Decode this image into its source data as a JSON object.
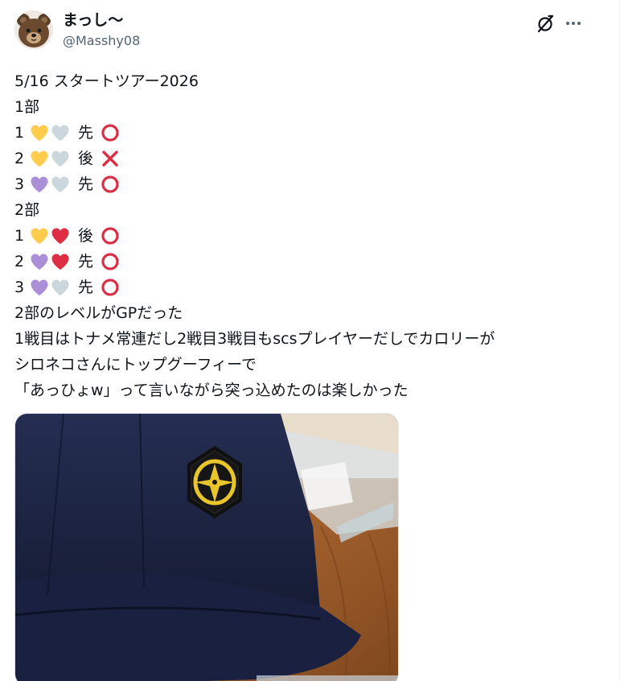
{
  "user": {
    "display_name": "まっし〜",
    "handle": "@Masshy08"
  },
  "icons": {
    "avatar": "teddy-bear-avatar",
    "grok": "grok-slash-icon",
    "more": "more-horizontal-icon"
  },
  "tweet": {
    "title_line": "5/16 スタートツアー2026",
    "part1_label": "1部",
    "part1_matches": [
      {
        "num": "1",
        "hearts": [
          "yellow",
          "white"
        ],
        "order": "先",
        "result": "circle"
      },
      {
        "num": "2",
        "hearts": [
          "yellow",
          "white"
        ],
        "order": "後",
        "result": "cross"
      },
      {
        "num": "3",
        "hearts": [
          "purple",
          "white"
        ],
        "order": "先",
        "result": "circle"
      }
    ],
    "part2_label": "2部",
    "part2_matches": [
      {
        "num": "1",
        "hearts": [
          "yellow",
          "red"
        ],
        "order": "後",
        "result": "circle"
      },
      {
        "num": "2",
        "hearts": [
          "purple",
          "red"
        ],
        "order": "先",
        "result": "circle"
      },
      {
        "num": "3",
        "hearts": [
          "purple",
          "white"
        ],
        "order": "先",
        "result": "circle"
      }
    ],
    "comment_lines": [
      "2部のレベルがGPだった",
      "1戦目はトナメ常連だし2戦目3戦目もscsプレイヤーだしでカロリーが",
      "シロネコさんにトップグーフィーで",
      "「あっひょw」って言いながら突っ込めたのは楽しかった"
    ]
  },
  "colors": {
    "heart_yellow": "#ffcc4d",
    "heart_white": "#ccd6dd",
    "heart_purple": "#aa8ed6",
    "heart_red": "#dd2e44",
    "mark_red": "#dd2e44",
    "cap_navy": "#1b2340",
    "emblem_gold": "#e8c52a",
    "table_wood": "#9a5a2a"
  }
}
